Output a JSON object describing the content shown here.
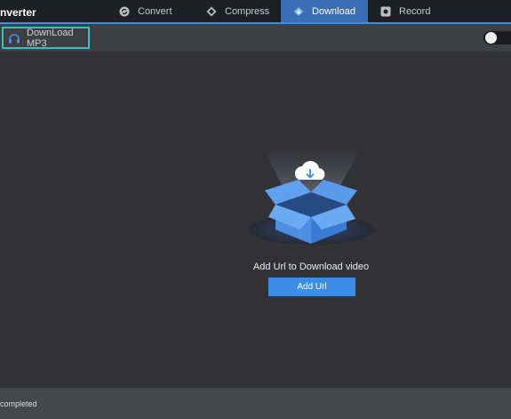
{
  "app": {
    "title": "nverter"
  },
  "tabs": [
    {
      "label": "Convert",
      "icon": "convert-icon",
      "active": false
    },
    {
      "label": "Compress",
      "icon": "compress-icon",
      "active": false
    },
    {
      "label": "Download",
      "icon": "download-icon",
      "active": true
    },
    {
      "label": "Record",
      "icon": "record-icon",
      "active": false
    }
  ],
  "toolbar": {
    "mp3_label": "DownLoad MP3",
    "mp3_icon": "headphones-icon",
    "toggle_on": false
  },
  "main": {
    "prompt": "Add Url to Download video",
    "add_button": "Add Url",
    "illustration_icon": "cloud-download-box-icon"
  },
  "status": {
    "text": "completed"
  },
  "colors": {
    "accent": "#3b8de8",
    "highlight": "#2ec4c0",
    "active_tab": "#3b6fb5"
  }
}
